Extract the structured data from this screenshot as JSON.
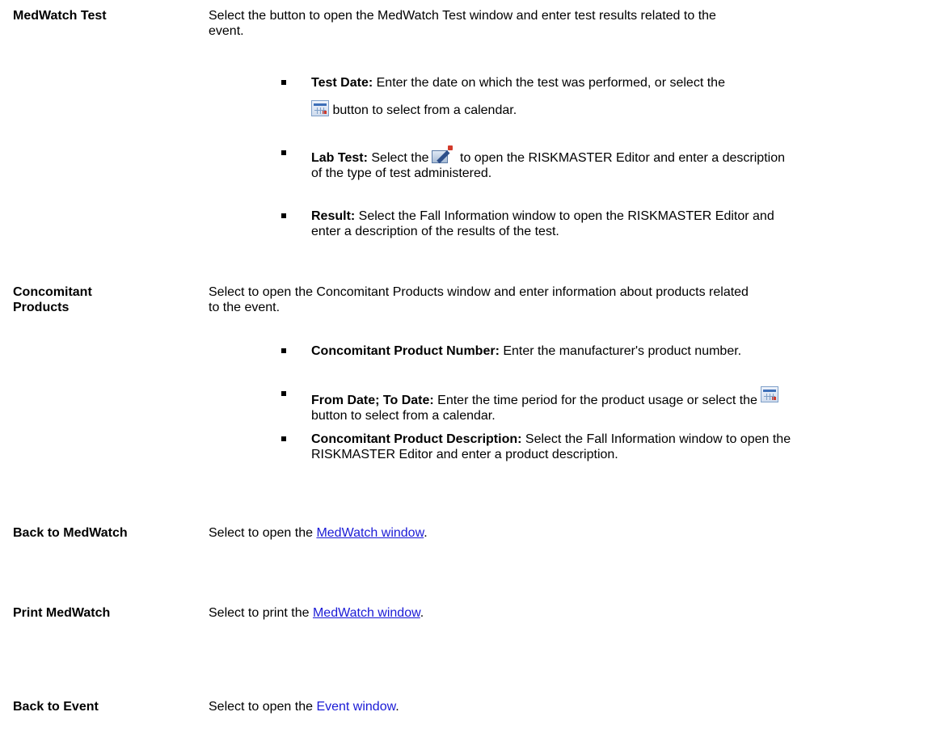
{
  "rows": {
    "medwatch_test": {
      "term": "MedWatch Test",
      "desc_line1": "Select the button to open the MedWatch Test window and enter test results related to the",
      "desc_line2": "event.",
      "bullets": {
        "test_date": {
          "label": "Test Date:",
          "text_line1": " Enter the date on which the test was performed, or select the",
          "text_line2": " button to select from a calendar."
        },
        "lab_test": {
          "label": "Lab Test:",
          "text_before_icon": " Select the",
          "text_after_icon": " to open the RISKMASTER Editor and enter a description",
          "text_line2": "of the type of test administered."
        },
        "result": {
          "label": "Result:",
          "text_line1": " Select the Fall Information window to open the RISKMASTER Editor and",
          "text_line2": "enter a description of the results of the test."
        }
      }
    },
    "concomitant_products": {
      "term_line1": "Concomitant",
      "term_line2": "Products",
      "desc_line1": "Select to open the Concomitant Products window and enter information about products related",
      "desc_line2": "to the event.",
      "bullets": {
        "product_number": {
          "label": "Concomitant Product Number:",
          "text": " Enter the manufacturer's product number."
        },
        "dates": {
          "label": "From Date; To Date:",
          "text_line1": " Enter the time period for the product usage or select the",
          "text_line2": "button to select from a calendar."
        },
        "description": {
          "label": "Concomitant Product Description:",
          "text_line1": " Select the Fall Information window to open the",
          "text_line2": "RISKMASTER Editor and enter a product description."
        }
      }
    },
    "back_to_medwatch": {
      "term": "Back to MedWatch",
      "desc_prefix": "Select to open the ",
      "link": "MedWatch window",
      "desc_suffix": "."
    },
    "print_medwatch": {
      "term": "Print MedWatch",
      "desc_prefix": "Select to print the ",
      "link": "MedWatch window",
      "desc_suffix": "."
    },
    "back_to_event": {
      "term": "Back to Event",
      "desc_prefix": "Select to open the ",
      "link": "Event window",
      "desc_suffix": "."
    }
  },
  "icons": {
    "calendar": "calendar-icon",
    "editor": "editor-icon"
  },
  "colors": {
    "link": "#1a1ad6",
    "text": "#000000",
    "background": "#ffffff"
  }
}
